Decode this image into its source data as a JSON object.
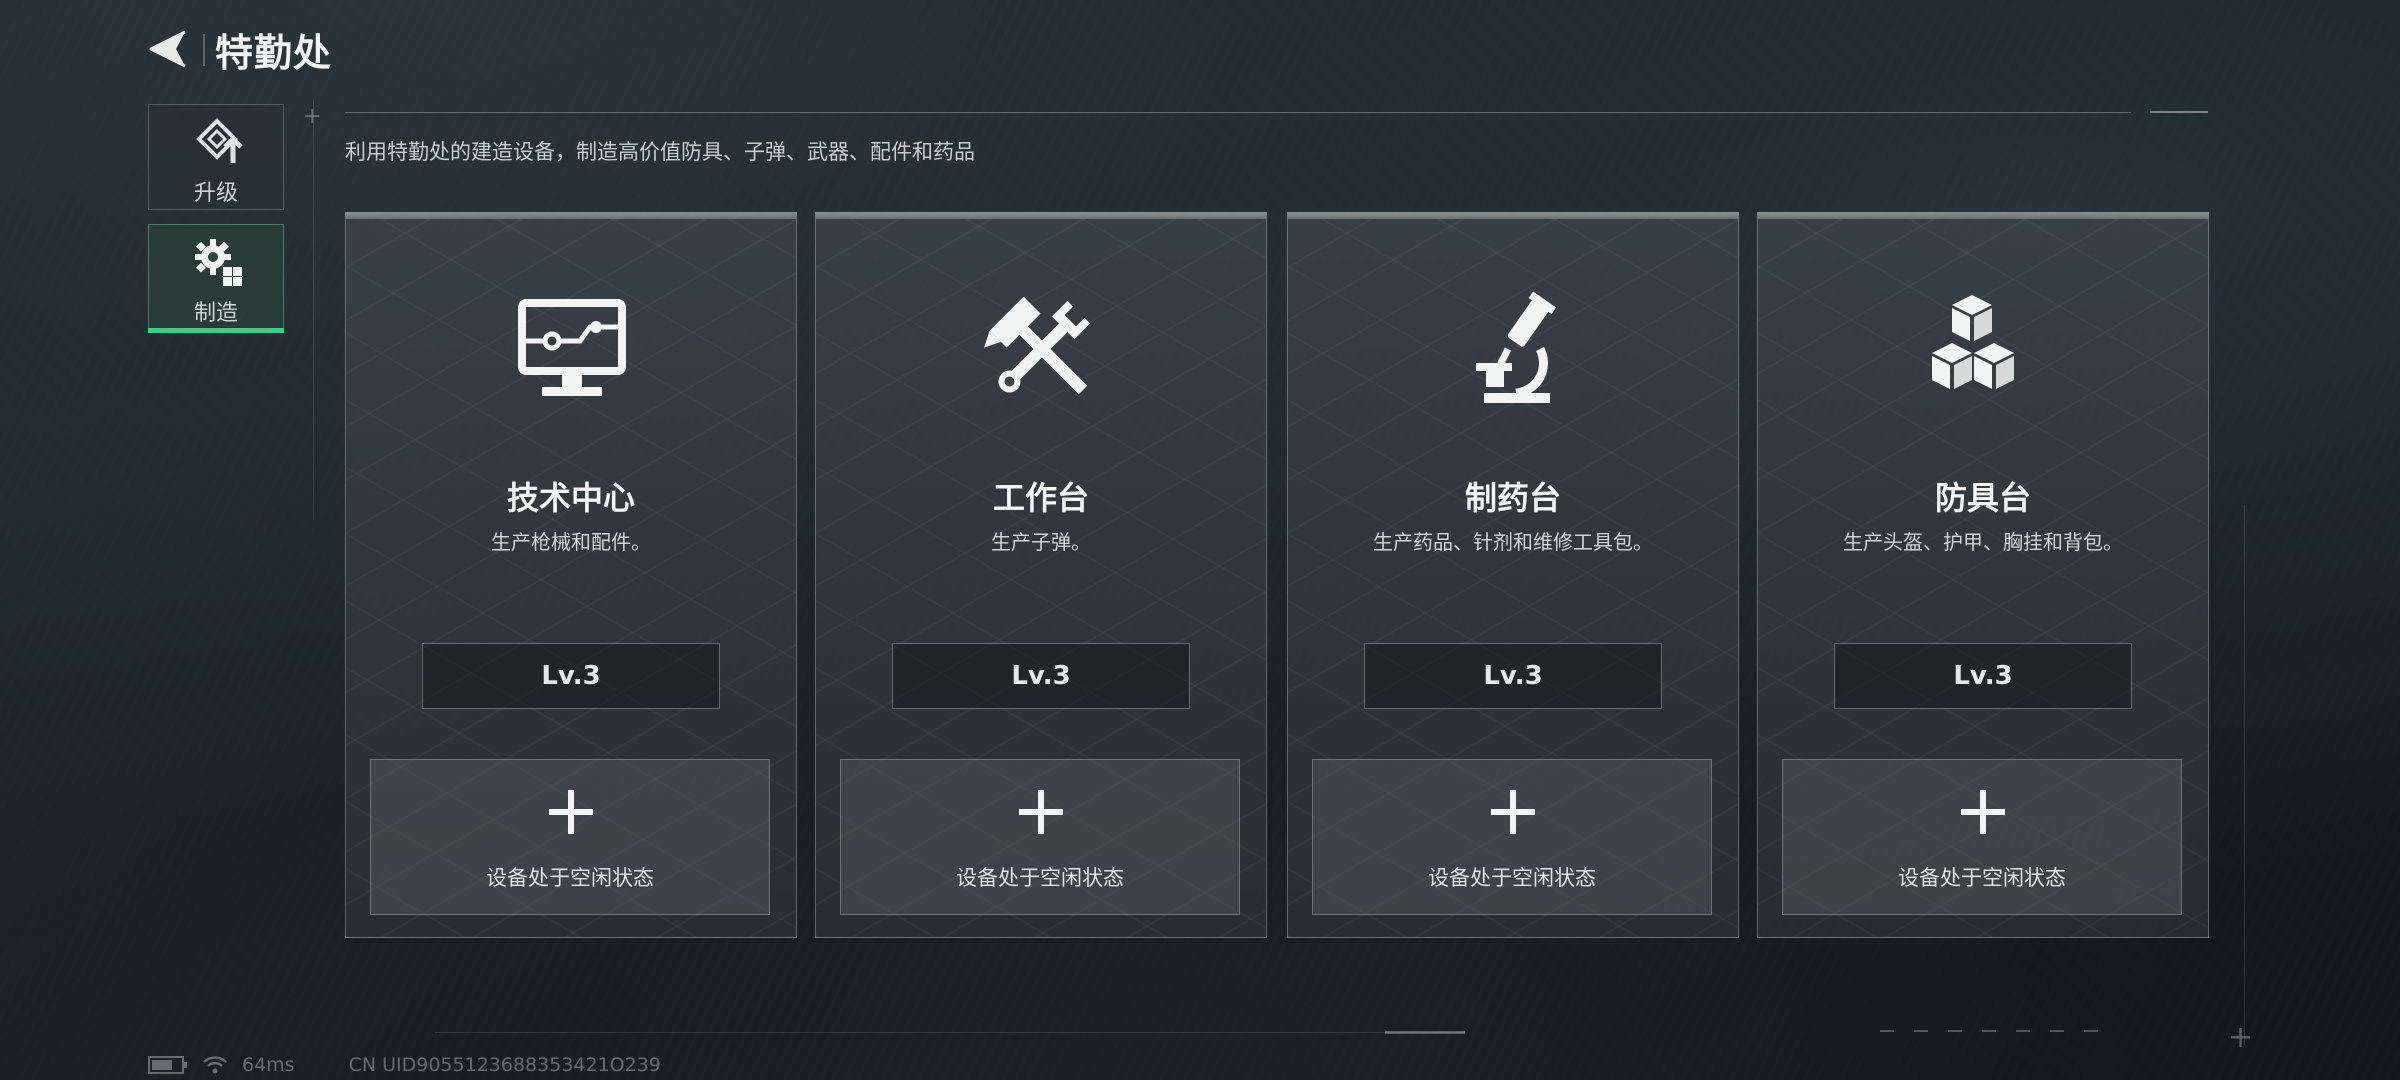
{
  "header": {
    "title": "特勤处"
  },
  "sidebar": {
    "tabs": [
      {
        "label": "升级",
        "icon": "upgrade-icon",
        "active": false
      },
      {
        "label": "制造",
        "icon": "gear-blocks-icon",
        "active": true
      }
    ]
  },
  "main": {
    "subtitle": "利用特勤处的建造设备，制造高价值防具、子弹、武器、配件和药品",
    "cards": [
      {
        "title": "技术中心",
        "desc": "生产枪械和配件。",
        "level": "Lv.3",
        "icon": "computer-circuit-icon",
        "slot_status": "设备处于空闲状态"
      },
      {
        "title": "工作台",
        "desc": "生产子弹。",
        "level": "Lv.3",
        "icon": "hammer-wrench-icon",
        "slot_status": "设备处于空闲状态"
      },
      {
        "title": "制药台",
        "desc": "生产药品、针剂和维修工具包。",
        "level": "Lv.3",
        "icon": "microscope-icon",
        "slot_status": "设备处于空闲状态"
      },
      {
        "title": "防具台",
        "desc": "生产头盔、护甲、胸挂和背包。",
        "level": "Lv.3",
        "icon": "cubes-icon",
        "slot_status": "设备处于空闲状态"
      }
    ]
  },
  "status_bar": {
    "ping": "64ms",
    "uid": "CN UID9055123688353421O239"
  },
  "colors": {
    "accent_green": "#4fc58c",
    "background": "#1a2226",
    "card_bg": "#3a4246"
  }
}
